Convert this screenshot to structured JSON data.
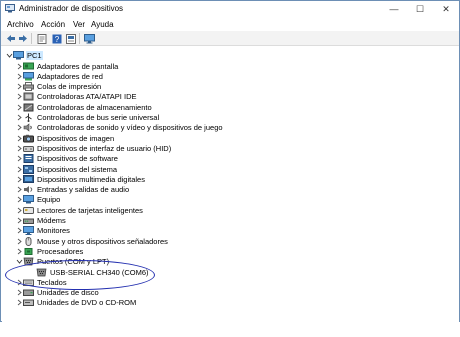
{
  "window": {
    "title": "Administrador de dispositivos",
    "controls": {
      "minimize": "—",
      "maximize": "☐",
      "close": "✕"
    }
  },
  "menu": [
    "Archivo",
    "Acción",
    "Ver",
    "Ayuda"
  ],
  "toolbar": {
    "buttons": [
      "back-icon",
      "forward-icon",
      "properties-icon",
      "help-icon",
      "update-icon",
      "monitor-icon"
    ]
  },
  "tree": {
    "root": {
      "label": "PC1",
      "icon": "computer-icon",
      "expanded": true
    },
    "categories": [
      {
        "label": "Adaptadores de pantalla",
        "icon": "display-adapter-icon",
        "expanded": false
      },
      {
        "label": "Adaptadores de red",
        "icon": "network-adapter-icon",
        "expanded": false
      },
      {
        "label": "Colas de impresión",
        "icon": "print-queue-icon",
        "expanded": false
      },
      {
        "label": "Controladoras ATA/ATAPI IDE",
        "icon": "ide-controller-icon",
        "expanded": false
      },
      {
        "label": "Controladoras de almacenamiento",
        "icon": "storage-controller-icon",
        "expanded": false
      },
      {
        "label": "Controladoras de bus serie universal",
        "icon": "usb-controller-icon",
        "expanded": false
      },
      {
        "label": "Controladoras de sonido y vídeo y dispositivos de juego",
        "icon": "sound-icon",
        "expanded": false
      },
      {
        "label": "Dispositivos de imagen",
        "icon": "camera-icon",
        "expanded": false
      },
      {
        "label": "Dispositivos de interfaz de usuario (HID)",
        "icon": "hid-icon",
        "expanded": false
      },
      {
        "label": "Dispositivos de software",
        "icon": "software-device-icon",
        "expanded": false
      },
      {
        "label": "Dispositivos del sistema",
        "icon": "system-device-icon",
        "expanded": false
      },
      {
        "label": "Dispositivos multimedia digitales",
        "icon": "multimedia-icon",
        "expanded": false
      },
      {
        "label": "Entradas y salidas de audio",
        "icon": "audio-io-icon",
        "expanded": false
      },
      {
        "label": "Equipo",
        "icon": "computer-icon",
        "expanded": false
      },
      {
        "label": "Lectores de tarjetas inteligentes",
        "icon": "smartcard-reader-icon",
        "expanded": false
      },
      {
        "label": "Módems",
        "icon": "modem-icon",
        "expanded": false
      },
      {
        "label": "Monitores",
        "icon": "monitor-icon",
        "expanded": false
      },
      {
        "label": "Mouse y otros dispositivos señaladores",
        "icon": "mouse-icon",
        "expanded": false
      },
      {
        "label": "Procesadores",
        "icon": "processor-icon",
        "expanded": false
      },
      {
        "label": "Puertos (COM y LPT)",
        "icon": "port-icon",
        "expanded": true
      },
      {
        "label": "USB-SERIAL CH340 (COM6)",
        "icon": "port-icon",
        "child": true
      },
      {
        "label": "Teclados",
        "icon": "keyboard-icon",
        "expanded": false
      },
      {
        "label": "Unidades de disco",
        "icon": "disk-drive-icon",
        "expanded": false
      },
      {
        "label": "Unidades de DVD o CD-ROM",
        "icon": "dvd-drive-icon",
        "expanded": false
      }
    ]
  },
  "colors": {
    "selection": "#cce8ff",
    "annotation": "#2430b0",
    "window_border": "#6d8fb5"
  }
}
